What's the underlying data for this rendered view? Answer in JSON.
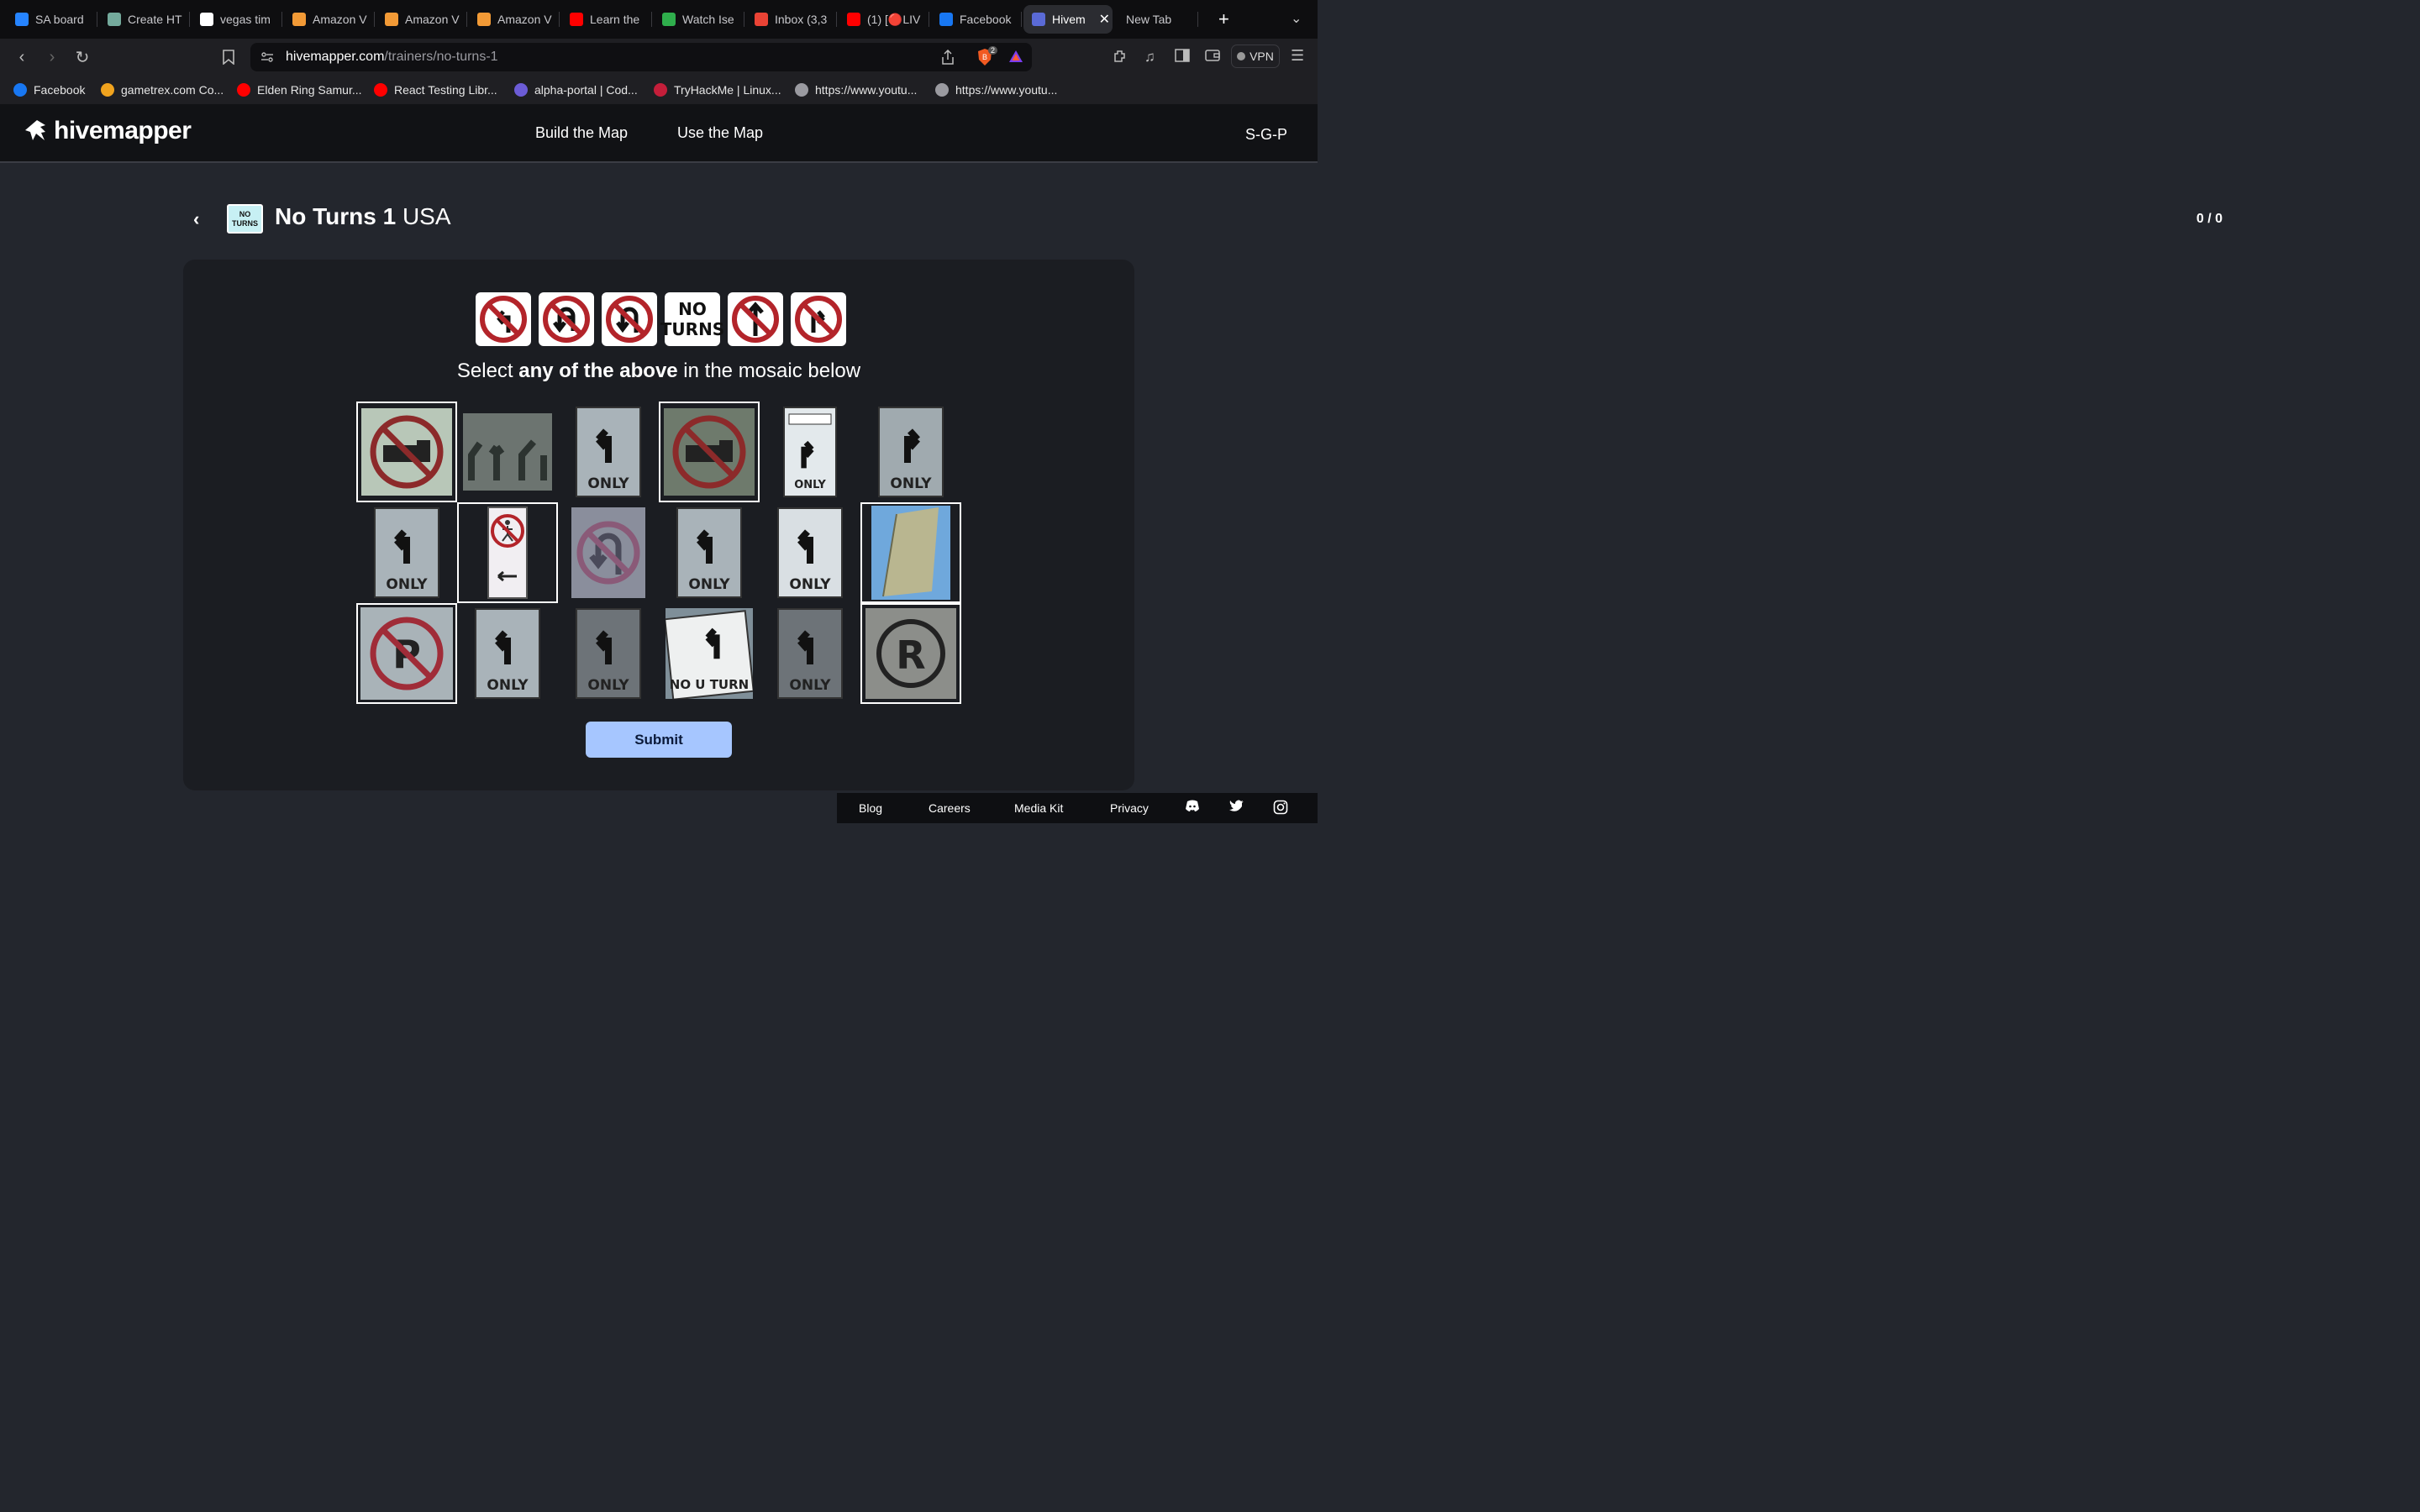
{
  "browser": {
    "tabs": [
      {
        "label": "SA board",
        "icon": "jira-icon",
        "color": "#2684ff"
      },
      {
        "label": "Create HT",
        "icon": "chatgpt-icon",
        "color": "#74aa9c"
      },
      {
        "label": "vegas tim",
        "icon": "google-icon",
        "color": "#ffffff"
      },
      {
        "label": "Amazon V",
        "icon": "aws-icon",
        "color": "#f29a36"
      },
      {
        "label": "Amazon V",
        "icon": "aws-icon",
        "color": "#f29a36"
      },
      {
        "label": "Amazon V",
        "icon": "aws-icon",
        "color": "#f29a36"
      },
      {
        "label": "Learn the",
        "icon": "youtube-icon",
        "color": "#ff0000"
      },
      {
        "label": "Watch Ise",
        "icon": "tv-icon",
        "color": "#2fae4c"
      },
      {
        "label": "Inbox (3,3",
        "icon": "gmail-icon",
        "color": "#ea4335"
      },
      {
        "label": "(1) [🔴LIV",
        "icon": "youtube-icon",
        "color": "#ff0000"
      },
      {
        "label": "Facebook",
        "icon": "facebook-icon",
        "color": "#1877f2"
      },
      {
        "label": "Hivem",
        "icon": "hivemapper-icon",
        "color": "#5a6ad6",
        "active": true
      },
      {
        "label": "New Tab",
        "icon": "",
        "color": ""
      }
    ],
    "url_host": "hivemapper.com",
    "url_path": "/trainers/no-turns-1",
    "shields_count": "2",
    "vpn_label": "VPN",
    "bookmarks": [
      {
        "label": "Facebook",
        "color": "#1877f2"
      },
      {
        "label": "gametrex.com Co...",
        "color": "#f0a31e"
      },
      {
        "label": "Elden Ring Samur...",
        "color": "#ff0000"
      },
      {
        "label": "React Testing Libr...",
        "color": "#ff0000"
      },
      {
        "label": "alpha-portal | Cod...",
        "color": "#6c5cd6"
      },
      {
        "label": "TryHackMe | Linux...",
        "color": "#c41e3a"
      },
      {
        "label": "https://www.youtu...",
        "color": "#9a9aa0"
      },
      {
        "label": "https://www.youtu...",
        "color": "#9a9aa0"
      }
    ]
  },
  "site": {
    "logo": "hivemapper",
    "nav": [
      "Build the Map",
      "Use the Map"
    ],
    "user": "S-G-P"
  },
  "trainer": {
    "badge_line1": "NO",
    "badge_line2": "TURNS",
    "title_bold": "No Turns 1",
    "title_region": "USA",
    "counter": "0 / 0",
    "reference_signs": [
      "no-left-turn-sign",
      "no-left-u-turn-sign",
      "no-u-turn-sign",
      "no-turns-text-sign",
      "no-straight-sign",
      "no-right-turn-sign"
    ],
    "ref_text_line1": "NO",
    "ref_text_line2": "TURNS",
    "instruction_prefix": "Select ",
    "instruction_bold": "any of the above",
    "instruction_suffix": " in the mosaic below",
    "submit_label": "Submit"
  },
  "mosaic": [
    {
      "kind": "no-trucks",
      "selected": true
    },
    {
      "kind": "lane-arrows",
      "selected": false
    },
    {
      "kind": "left-only",
      "selected": false,
      "text": "ONLY"
    },
    {
      "kind": "no-trucks-dark",
      "selected": true
    },
    {
      "kind": "right-only-small",
      "selected": false,
      "text": "ONLY"
    },
    {
      "kind": "right-only",
      "selected": false,
      "text": "ONLY"
    },
    {
      "kind": "left-only",
      "selected": false,
      "text": "ONLY"
    },
    {
      "kind": "no-pedestrians",
      "selected": true
    },
    {
      "kind": "no-u-turn-blur",
      "selected": false
    },
    {
      "kind": "left-only",
      "selected": false,
      "text": "ONLY"
    },
    {
      "kind": "left-only-bright",
      "selected": false,
      "text": "ONLY"
    },
    {
      "kind": "blank-sign",
      "selected": true
    },
    {
      "kind": "no-parking",
      "selected": true
    },
    {
      "kind": "left-only",
      "selected": false,
      "text": "ONLY"
    },
    {
      "kind": "left-only-dark",
      "selected": false,
      "text": "ONLY"
    },
    {
      "kind": "left-no-u-turn",
      "selected": false,
      "text": "NO U TURN"
    },
    {
      "kind": "left-only-dark",
      "selected": false,
      "text": "ONLY"
    },
    {
      "kind": "parking-circle",
      "selected": true
    }
  ],
  "footer": {
    "links": [
      "Blog",
      "Careers",
      "Media Kit",
      "Privacy"
    ],
    "icons": [
      "discord-icon",
      "twitter-icon",
      "instagram-icon"
    ]
  }
}
